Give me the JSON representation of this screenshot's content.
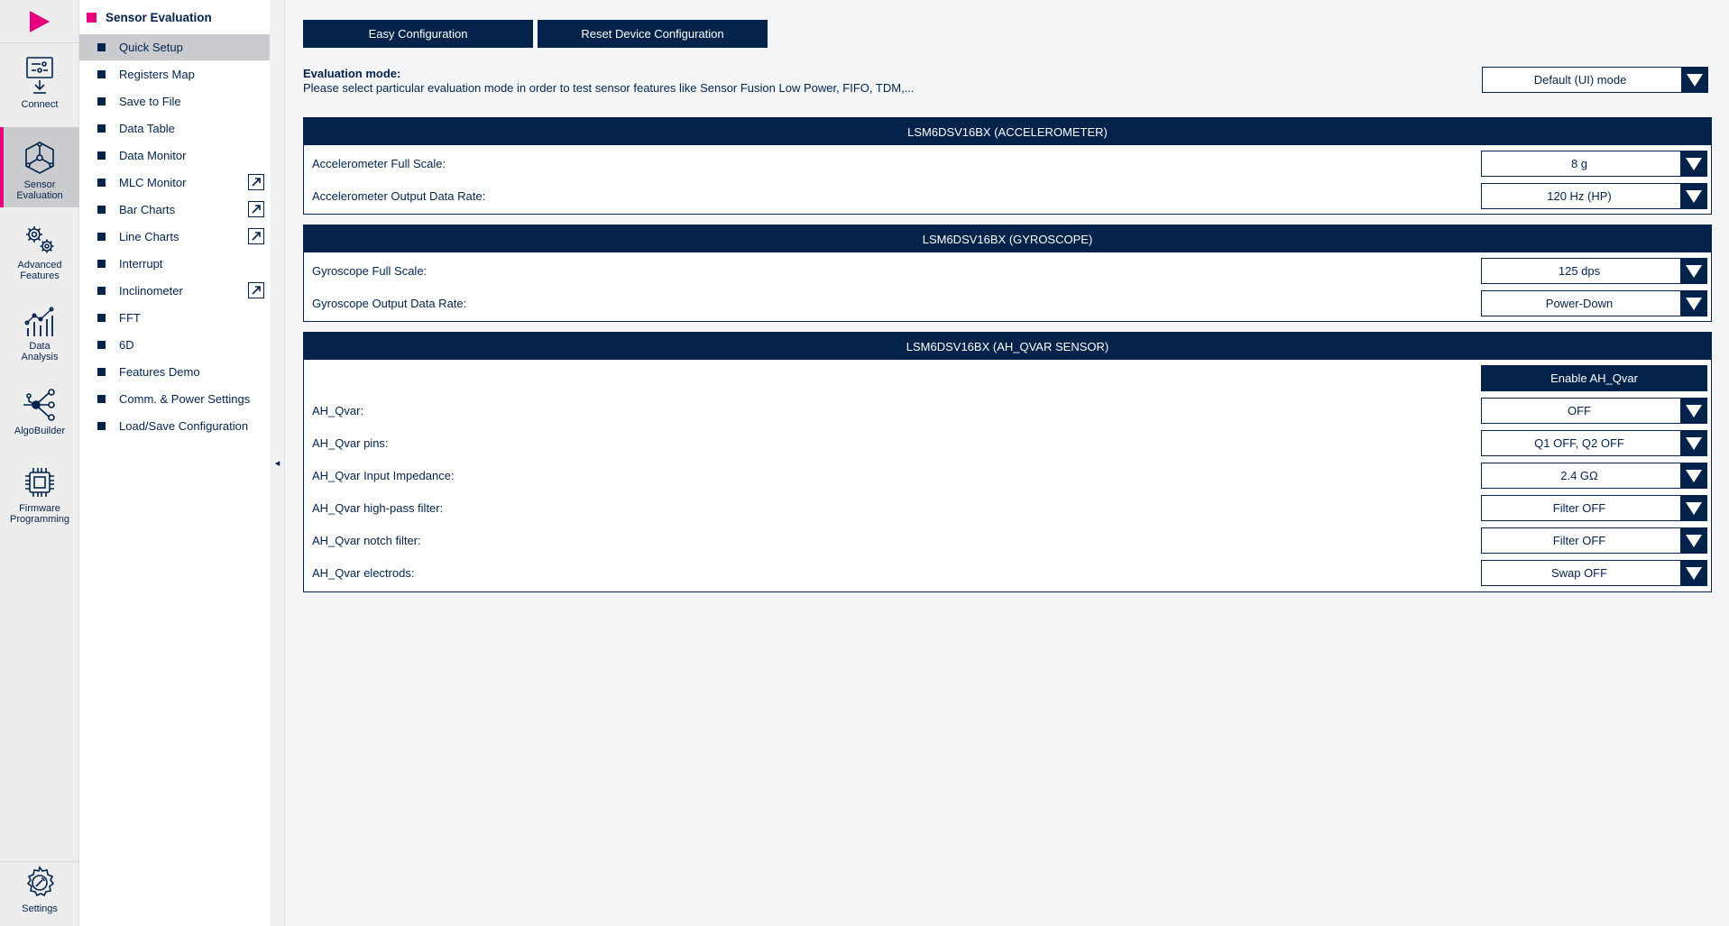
{
  "rail": {
    "items": [
      {
        "label": "Connect",
        "icon": "connect-icon"
      },
      {
        "label": "Sensor\nEvaluation",
        "icon": "sensor-evaluation-icon"
      },
      {
        "label": "Advanced\nFeatures",
        "icon": "gears-icon"
      },
      {
        "label": "Data\nAnalysis",
        "icon": "data-analysis-icon"
      },
      {
        "label": "AlgoBuilder",
        "icon": "algobuilder-icon"
      },
      {
        "label": "Firmware\nProgramming",
        "icon": "chip-icon"
      },
      {
        "label": "Settings",
        "icon": "settings-icon"
      }
    ]
  },
  "menu": {
    "title": "Sensor Evaluation",
    "items": [
      {
        "label": "Quick Setup"
      },
      {
        "label": "Registers Map"
      },
      {
        "label": "Save to File"
      },
      {
        "label": "Data Table"
      },
      {
        "label": "Data Monitor"
      },
      {
        "label": "MLC Monitor"
      },
      {
        "label": "Bar Charts"
      },
      {
        "label": "Line Charts"
      },
      {
        "label": "Interrupt"
      },
      {
        "label": "Inclinometer"
      },
      {
        "label": "FFT"
      },
      {
        "label": "6D"
      },
      {
        "label": "Features Demo"
      },
      {
        "label": "Comm. & Power Settings"
      },
      {
        "label": "Load/Save Configuration"
      }
    ],
    "collapse_glyph": "◂"
  },
  "toolbar": {
    "easy_config": "Easy Configuration",
    "reset_config": "Reset Device Configuration"
  },
  "evaluation": {
    "title": "Evaluation mode:",
    "description": "Please select particular evaluation mode in order to test sensor features like Sensor Fusion Low Power, FIFO, TDM,...",
    "mode": "Default (UI) mode"
  },
  "accelerometer": {
    "header": "LSM6DSV16BX (ACCELEROMETER)",
    "full_scale_label": "Accelerometer Full Scale:",
    "full_scale_value": "8 g",
    "odr_label": "Accelerometer Output Data Rate:",
    "odr_value": "120 Hz (HP)"
  },
  "gyroscope": {
    "header": "LSM6DSV16BX (GYROSCOPE)",
    "full_scale_label": "Gyroscope Full Scale:",
    "full_scale_value": "125 dps",
    "odr_label": "Gyroscope Output Data Rate:",
    "odr_value": "Power-Down"
  },
  "qvar": {
    "header": "LSM6DSV16BX (AH_QVAR SENSOR)",
    "enable_label": "Enable AH_Qvar",
    "rows": [
      {
        "label": "AH_Qvar:",
        "value": "OFF"
      },
      {
        "label": "AH_Qvar pins:",
        "value": "Q1 OFF, Q2 OFF"
      },
      {
        "label": "AH_Qvar Input Impedance:",
        "value": "2.4 GΩ"
      },
      {
        "label": "AH_Qvar high-pass filter:",
        "value": "Filter OFF"
      },
      {
        "label": "AH_Qvar notch filter:",
        "value": "Filter OFF"
      },
      {
        "label": "AH_Qvar electrods:",
        "value": "Swap OFF"
      }
    ]
  },
  "colors": {
    "brand_dark": "#03234b",
    "accent": "#e6007e"
  }
}
